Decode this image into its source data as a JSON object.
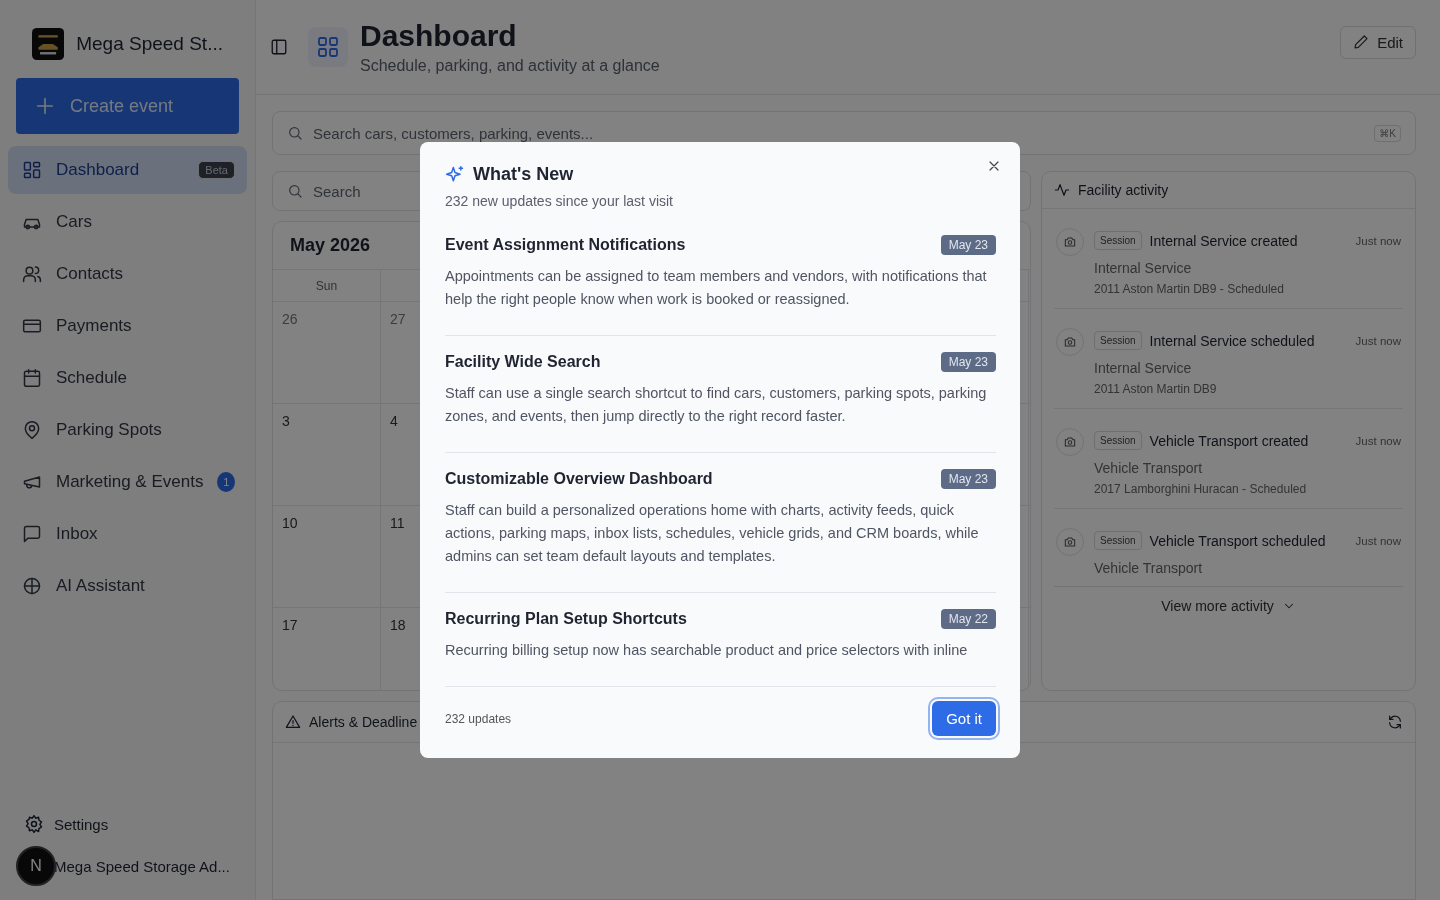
{
  "sidebar": {
    "brand": "Mega Speed St...",
    "create_button": "Create event",
    "items": [
      {
        "label": "Dashboard",
        "selected": true,
        "badge": {
          "text": "Beta",
          "kind": "tag"
        }
      },
      {
        "label": "Cars",
        "selected": false
      },
      {
        "label": "Contacts",
        "selected": false
      },
      {
        "label": "Payments",
        "selected": false
      },
      {
        "label": "Schedule",
        "selected": false
      },
      {
        "label": "Parking Spots",
        "selected": false
      },
      {
        "label": "Marketing & Events",
        "selected": false,
        "badge": {
          "text": "1",
          "kind": "count"
        }
      },
      {
        "label": "Inbox",
        "selected": false
      },
      {
        "label": "AI Assistant",
        "selected": false
      }
    ],
    "settings": "Settings",
    "user": {
      "initial": "N",
      "name": "Mega Speed Storage Ad..."
    }
  },
  "header": {
    "title": "Dashboard",
    "subtitle": "Schedule, parking, and activity at a glance",
    "edit_button": "Edit"
  },
  "global_search": {
    "placeholder": "Search cars, customers, parking, events...",
    "shortcut": "⌘K"
  },
  "calendar": {
    "search_placeholder": "Search",
    "month": "May 2026",
    "weekdays": [
      "Sun"
    ],
    "weeks": [
      [
        "26",
        "27"
      ],
      [
        "3",
        "4"
      ],
      [
        "10",
        "11"
      ],
      [
        "17",
        "18"
      ]
    ]
  },
  "activity": {
    "title": "Facility activity",
    "items": [
      {
        "tag": "Session",
        "title": "Internal Service created",
        "time": "Just now",
        "subtitle": "Internal Service",
        "detail": "2011 Aston Martin DB9 - Scheduled"
      },
      {
        "tag": "Session",
        "title": "Internal Service scheduled",
        "time": "Just now",
        "subtitle": "Internal Service",
        "detail": "2011 Aston Martin DB9"
      },
      {
        "tag": "Session",
        "title": "Vehicle Transport created",
        "time": "Just now",
        "subtitle": "Vehicle Transport",
        "detail": "2017 Lamborghini Huracan - Scheduled"
      },
      {
        "tag": "Session",
        "title": "Vehicle Transport scheduled",
        "time": "Just now",
        "subtitle": "Vehicle Transport"
      }
    ],
    "more_button": "View more activity"
  },
  "alerts": {
    "title": "Alerts & Deadline"
  },
  "modal": {
    "title": "What's New",
    "subtitle": "232 new updates since your last visit",
    "updates": [
      {
        "title": "Event Assignment Notifications",
        "date": "May 23",
        "body": "Appointments can be assigned to team members and vendors, with notifications that help the right people know when work is booked or reassigned."
      },
      {
        "title": "Facility Wide Search",
        "date": "May 23",
        "body": "Staff can use a single search shortcut to find cars, customers, parking spots, parking zones, and events, then jump directly to the right record faster."
      },
      {
        "title": "Customizable Overview Dashboard",
        "date": "May 23",
        "body": "Staff can build a personalized operations home with charts, activity feeds, quick actions, parking maps, inbox lists, schedules, vehicle grids, and CRM boards, while admins can set team default layouts and templates."
      },
      {
        "title": "Recurring Plan Setup Shortcuts",
        "date": "May 22",
        "body": "Recurring billing setup now has searchable product and price selectors with inline"
      }
    ],
    "footer_count": "232 updates",
    "button": "Got it"
  }
}
